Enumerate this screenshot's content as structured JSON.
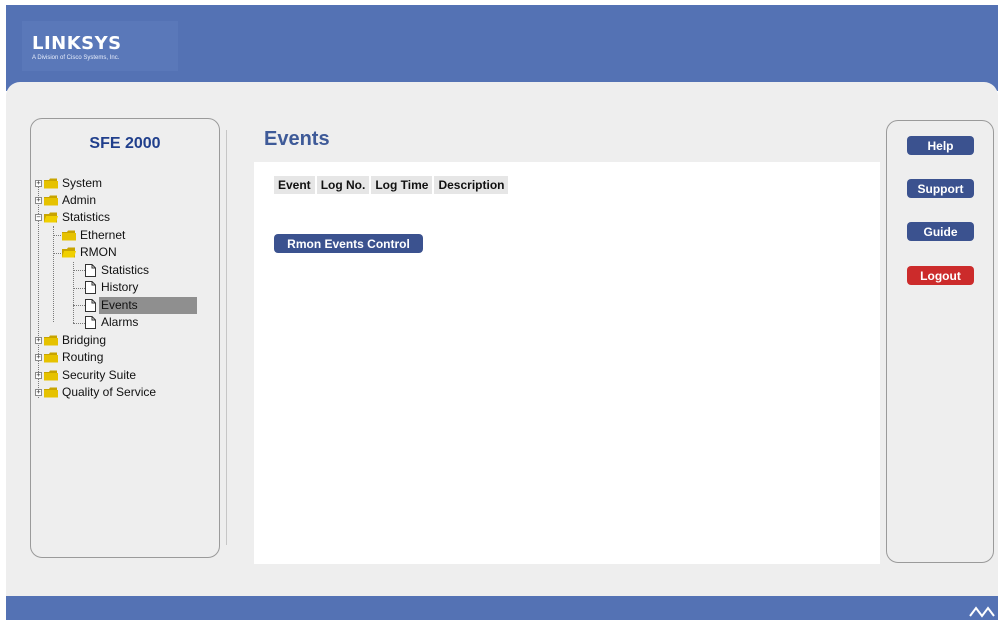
{
  "brand": {
    "name": "Linksys",
    "tagline": "A Division of Cisco Systems, Inc.",
    "footer_mark": "Cisco Systems"
  },
  "nav": {
    "device_title": "SFE 2000",
    "items": [
      {
        "label": "System",
        "type": "folder",
        "expanded": false
      },
      {
        "label": "Admin",
        "type": "folder",
        "expanded": false
      },
      {
        "label": "Statistics",
        "type": "folder",
        "expanded": true
      },
      {
        "label": "Ethernet",
        "type": "folder"
      },
      {
        "label": "RMON",
        "type": "folder",
        "expanded": true
      },
      {
        "label": "Statistics",
        "type": "page"
      },
      {
        "label": "History",
        "type": "page"
      },
      {
        "label": "Events",
        "type": "page",
        "selected": true
      },
      {
        "label": "Alarms",
        "type": "page"
      },
      {
        "label": "Bridging",
        "type": "folder",
        "expanded": false
      },
      {
        "label": "Routing",
        "type": "folder",
        "expanded": false
      },
      {
        "label": "Security Suite",
        "type": "folder",
        "expanded": false
      },
      {
        "label": "Quality of Service",
        "type": "folder",
        "expanded": false
      }
    ]
  },
  "main": {
    "title": "Events",
    "columns": [
      "Event",
      "Log No.",
      "Log Time",
      "Description"
    ],
    "rmon_button": "Rmon Events Control"
  },
  "side": {
    "help": "Help",
    "support": "Support",
    "guide": "Guide",
    "logout": "Logout"
  },
  "colors": {
    "header": "#5472b4",
    "nav_title": "#203f8c",
    "page_title": "#3e5a98",
    "primary_button": "#3b528f",
    "logout_button": "#cc2b2b",
    "selected_row": "#8f8f8f"
  }
}
